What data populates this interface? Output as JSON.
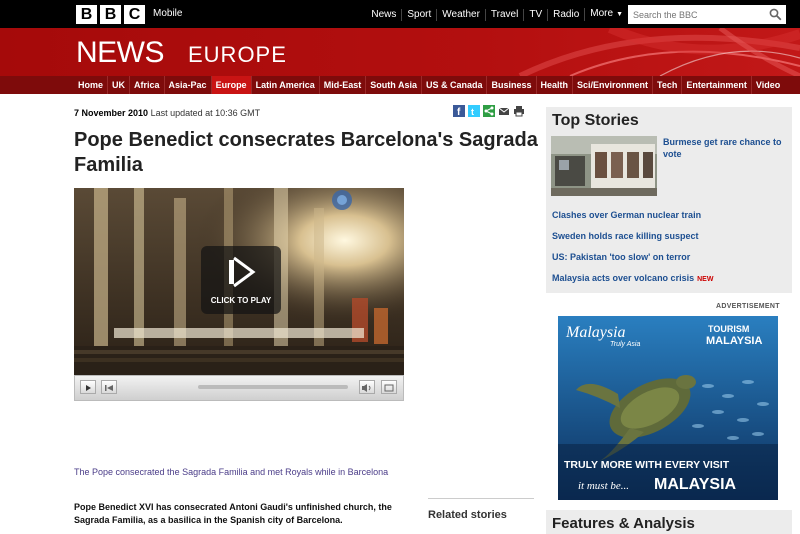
{
  "header": {
    "logo_letters": [
      "B",
      "B",
      "C"
    ],
    "mobile_link": "Mobile",
    "nav": [
      "News",
      "Sport",
      "Weather",
      "Travel",
      "TV",
      "Radio"
    ],
    "more": "More",
    "search_placeholder": "Search the BBC"
  },
  "masthead": {
    "news": "NEWS",
    "section": "EUROPE"
  },
  "section_nav": [
    "Home",
    "UK",
    "Africa",
    "Asia-Pac",
    "Europe",
    "Latin America",
    "Mid-East",
    "South Asia",
    "US & Canada",
    "Business",
    "Health",
    "Sci/Environment",
    "Tech",
    "Entertainment",
    "Video"
  ],
  "section_nav_active": "Europe",
  "article": {
    "date": "7 November 2010",
    "updated": "Last updated at 10:36 GMT",
    "share_icons": [
      "facebook-icon",
      "twitter-icon",
      "share-icon",
      "email-icon",
      "print-icon"
    ],
    "headline": "Pope Benedict consecrates Barcelona's Sagrada Familia",
    "video": {
      "play_label": "CLICK TO PLAY"
    },
    "caption": "The Pope consecrated the Sagrada Familia and met Royals while in Barcelona",
    "body": "Pope Benedict XVI has consecrated Antoni Gaudi's unfinished church, the Sagrada Familia, as a basilica in the Spanish city of Barcelona.",
    "related_title": "Related stories"
  },
  "sidebar": {
    "top_stories_title": "Top Stories",
    "lead_story": "Burmese get rare chance to vote",
    "stories": [
      {
        "text": "Clashes over German nuclear train",
        "badge": ""
      },
      {
        "text": "Sweden holds race killing suspect",
        "badge": ""
      },
      {
        "text": "US: Pakistan 'too slow' on terror",
        "badge": ""
      },
      {
        "text": "Malaysia acts over volcano crisis",
        "badge": "NEW"
      }
    ],
    "advert_label": "ADVERTISEMENT",
    "ad": {
      "brand_script": "Malaysia",
      "brand_tag": "Truly Asia",
      "tourism_line1": "TOURISM",
      "tourism_line2": "MALAYSIA",
      "tagline": "TRULY MORE WITH EVERY VISIT",
      "it_must_be": "it must be...",
      "country": "MALAYSIA"
    },
    "features_title": "Features & Analysis"
  },
  "colors": {
    "bbc_red": "#b30f0f",
    "nav_red": "#7e0b0b",
    "active_tab": "#c91414",
    "link_blue": "#1d4f91",
    "caption_purple": "#4a3c88"
  }
}
